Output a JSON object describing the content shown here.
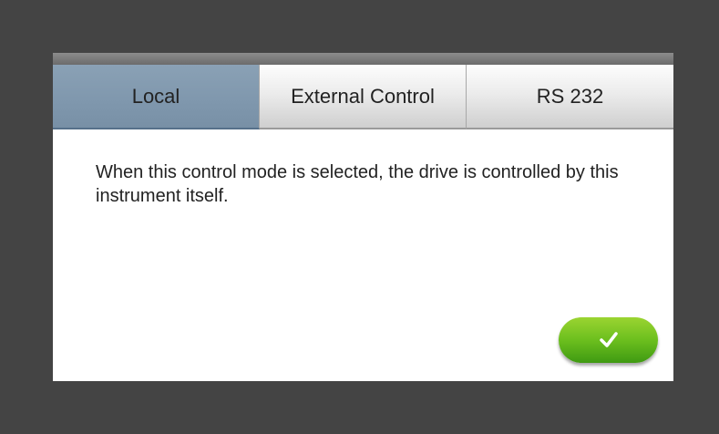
{
  "tabs": [
    {
      "label": "Local",
      "active": true
    },
    {
      "label": "External Control",
      "active": false
    },
    {
      "label": "RS 232",
      "active": false
    }
  ],
  "description": "When this control mode is selected, the drive is controlled by this instrument itself.",
  "confirm_button": {
    "icon": "check-icon"
  },
  "colors": {
    "background": "#444444",
    "active_tab": "#7f97ad",
    "confirm_green": "#6cbf1e"
  }
}
